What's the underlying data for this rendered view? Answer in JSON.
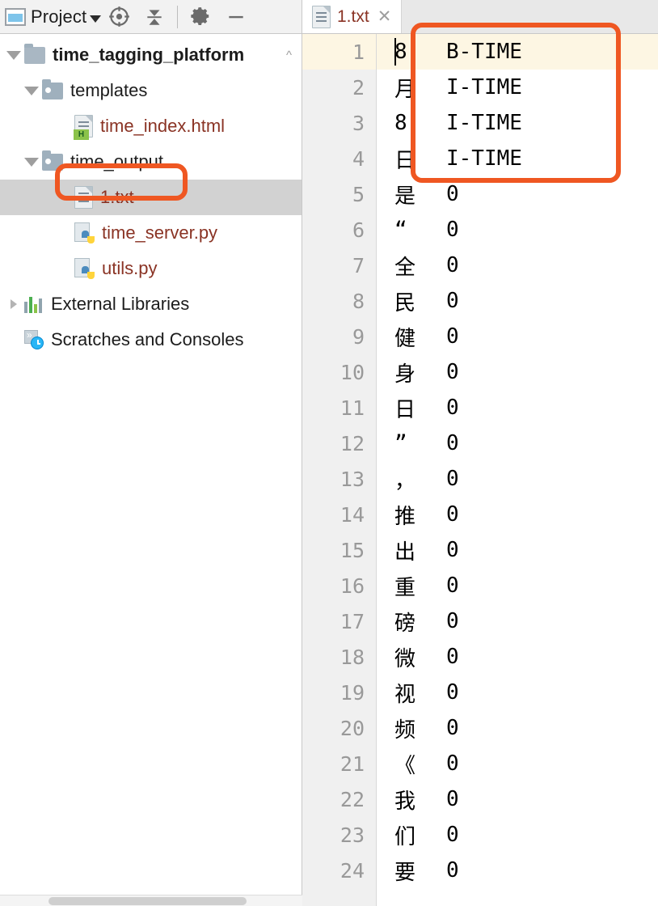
{
  "sidebar": {
    "toolbar": {
      "panel_icon": "project-panel-icon",
      "title": "Project",
      "dropdown_icon": "chevron-down-icon",
      "locate_icon": "crosshair-target-icon",
      "collapse_icon": "collapse-all-icon",
      "settings_icon": "gear-icon",
      "minimize_icon": "minimize-icon"
    },
    "tree": [
      {
        "label": "time_tagging_platform",
        "icon": "folder-icon",
        "twisty": "expanded",
        "depth": 0,
        "kind": "root",
        "collapse_hint": "^"
      },
      {
        "label": "templates",
        "icon": "folder-icon",
        "twisty": "expanded",
        "depth": 1,
        "kind": "folder"
      },
      {
        "label": "time_index.html",
        "icon": "html-file-icon",
        "twisty": "none",
        "depth": 2,
        "kind": "html"
      },
      {
        "label": "time_output",
        "icon": "folder-icon",
        "twisty": "expanded",
        "depth": 1,
        "kind": "folder"
      },
      {
        "label": "1.txt",
        "icon": "text-file-icon",
        "twisty": "none",
        "depth": 2,
        "kind": "txt",
        "selected": true
      },
      {
        "label": "time_server.py",
        "icon": "python-file-icon",
        "twisty": "none",
        "depth": 2,
        "kind": "py"
      },
      {
        "label": "utils.py",
        "icon": "python-file-icon",
        "twisty": "none",
        "depth": 2,
        "kind": "py"
      },
      {
        "label": "External Libraries",
        "icon": "library-icon",
        "twisty": "collapsed",
        "depth": 0,
        "kind": "lib"
      },
      {
        "label": "Scratches and Consoles",
        "icon": "scratches-icon",
        "twisty": "none",
        "depth": 0,
        "kind": "scratch"
      }
    ]
  },
  "editor": {
    "tab": {
      "label": "1.txt",
      "icon": "text-file-icon",
      "close_icon": "close-icon"
    },
    "current_line": 1,
    "lines": [
      {
        "n": "1",
        "char": "8",
        "tag": "B-TIME"
      },
      {
        "n": "2",
        "char": "月",
        "tag": "I-TIME"
      },
      {
        "n": "3",
        "char": "8",
        "tag": "I-TIME"
      },
      {
        "n": "4",
        "char": "日",
        "tag": "I-TIME"
      },
      {
        "n": "5",
        "char": "是",
        "tag": "0"
      },
      {
        "n": "6",
        "char": "“",
        "tag": "0"
      },
      {
        "n": "7",
        "char": "全",
        "tag": "0"
      },
      {
        "n": "8",
        "char": "民",
        "tag": "0"
      },
      {
        "n": "9",
        "char": "健",
        "tag": "0"
      },
      {
        "n": "10",
        "char": "身",
        "tag": "0"
      },
      {
        "n": "11",
        "char": "日",
        "tag": "0"
      },
      {
        "n": "12",
        "char": "”",
        "tag": "0"
      },
      {
        "n": "13",
        "char": "，",
        "tag": "0"
      },
      {
        "n": "14",
        "char": "推",
        "tag": "0"
      },
      {
        "n": "15",
        "char": "出",
        "tag": "0"
      },
      {
        "n": "16",
        "char": "重",
        "tag": "0"
      },
      {
        "n": "17",
        "char": "磅",
        "tag": "0"
      },
      {
        "n": "18",
        "char": "微",
        "tag": "0"
      },
      {
        "n": "19",
        "char": "视",
        "tag": "0"
      },
      {
        "n": "20",
        "char": "频",
        "tag": "0"
      },
      {
        "n": "21",
        "char": "《",
        "tag": "0"
      },
      {
        "n": "22",
        "char": "我",
        "tag": "0"
      },
      {
        "n": "23",
        "char": "们",
        "tag": "0"
      },
      {
        "n": "24",
        "char": "要",
        "tag": "0"
      }
    ]
  },
  "annotations": {
    "accent_color": "#ef5722",
    "file_box_target": "1.txt",
    "lines_box_target": "lines 1-4 B-TIME/I-TIME"
  }
}
